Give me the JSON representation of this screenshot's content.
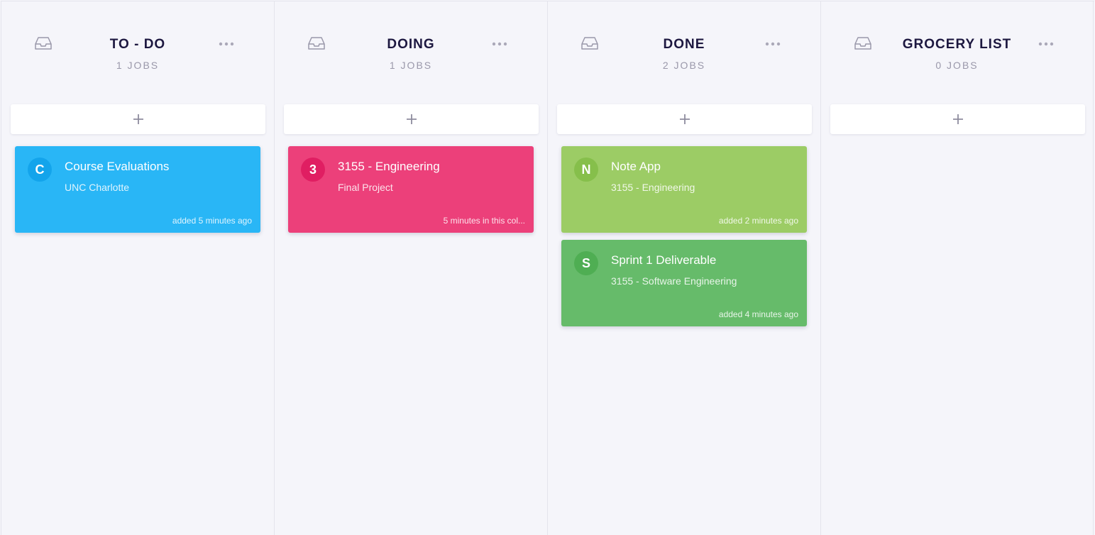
{
  "colors": {
    "background": "#f5f5fa",
    "card_blue": "#29b6f6",
    "card_blue_avatar": "#13a4eb",
    "card_pink": "#ec407a",
    "card_pink_avatar": "#e01e62",
    "card_lightgreen": "#9ccc65",
    "card_lightgreen_avatar": "#86bf4b",
    "card_green": "#66bb6a",
    "card_green_avatar": "#4fae53"
  },
  "icons": {
    "column_icon": "inbox-icon",
    "menu_icon": "more-horizontal-icon",
    "add_icon": "plus-icon"
  },
  "columns": [
    {
      "title": "TO - DO",
      "count": "1 JOBS",
      "cards": [
        {
          "initial": "C",
          "title": "Course Evaluations",
          "subtitle": "UNC Charlotte",
          "time": "added 5 minutes ago",
          "color": "#29b6f6",
          "avatar_color": "#13a4eb"
        }
      ]
    },
    {
      "title": "DOING",
      "count": "1 JOBS",
      "cards": [
        {
          "initial": "3",
          "title": "3155 - Engineering",
          "subtitle": "Final Project",
          "time": "5 minutes in this col...",
          "color": "#ec407a",
          "avatar_color": "#e01e62"
        }
      ]
    },
    {
      "title": "DONE",
      "count": "2 JOBS",
      "cards": [
        {
          "initial": "N",
          "title": "Note App",
          "subtitle": "3155 - Engineering",
          "time": "added 2 minutes ago",
          "color": "#9ccc65",
          "avatar_color": "#86bf4b"
        },
        {
          "initial": "S",
          "title": "Sprint 1 Deliverable",
          "subtitle": "3155 - Software Engineering",
          "time": "added 4 minutes ago",
          "color": "#66bb6a",
          "avatar_color": "#4fae53"
        }
      ]
    },
    {
      "title": "GROCERY LIST",
      "count": "0 JOBS",
      "cards": []
    }
  ]
}
